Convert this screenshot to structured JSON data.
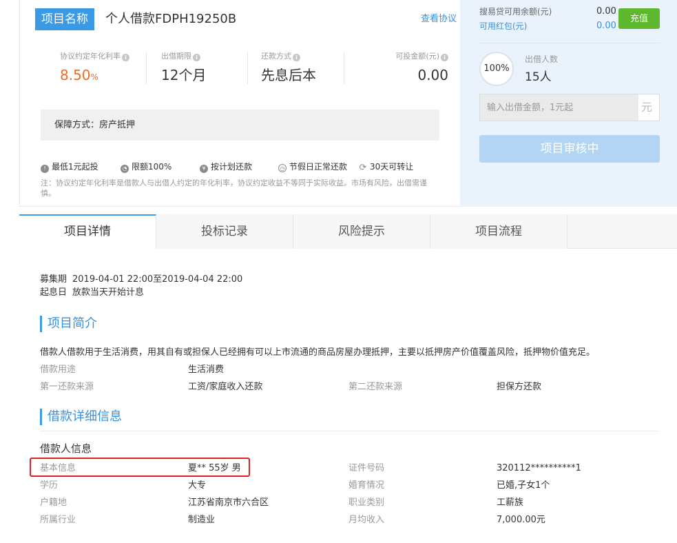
{
  "header": {
    "tag": "项目名称",
    "name": "个人借款FDPH19250B",
    "agreement_link": "查看协议"
  },
  "stats": [
    {
      "label": "协议约定年化利率",
      "value": "8.50",
      "unit": "%"
    },
    {
      "label": "出借期限",
      "value": "12个月"
    },
    {
      "label": "还款方式",
      "value": "先息后本"
    },
    {
      "label": "可投金额(元)",
      "value": "0.00"
    }
  ],
  "guarantee": "保障方式：房产抵押",
  "features": [
    {
      "icon": "info-icon",
      "label": "最低1元起投"
    },
    {
      "icon": "pie-icon",
      "label": "限额100%"
    },
    {
      "icon": "yen-icon",
      "label": "按计划还款"
    },
    {
      "icon": "clock-icon",
      "label": "节假日正常还款"
    },
    {
      "icon": "refresh-icon",
      "label": "30天可转让"
    }
  ],
  "note": "注：协议约定年化利率是借款人与出借人约定的年化利率，协议约定收益不等同于实际收益。市场有风险，出借需谨慎。",
  "right_panel": {
    "balance_label": "搜易贷可用余额(元)",
    "balance_value": "0.00",
    "redpacket_label": "可用红包(元)",
    "redpacket_value": "0.00",
    "recharge_button": "充值",
    "progress": "100%",
    "progress_fraction": 1.0,
    "investors_label": "出借人数",
    "investors_value": "15人",
    "amount_placeholder": "输入出借金额，1元起",
    "amount_unit": "元",
    "status_button": "项目审核中"
  },
  "tabs": [
    {
      "label": "项目详情",
      "active": true
    },
    {
      "label": "投标记录",
      "active": false
    },
    {
      "label": "风险提示",
      "active": false
    },
    {
      "label": "项目流程",
      "active": false
    }
  ],
  "schedule": {
    "raise_label": "募集期",
    "raise_value": "2019-04-01 22:00至2019-04-04 22:00",
    "interest_label": "起息日",
    "interest_value": "放款当天开始计息"
  },
  "intro": {
    "title": "项目简介",
    "description": "借款人借款用于生活消费，用其自有或担保人已经拥有可以上市流通的商品房屋办理抵押，主要以抵押房产价值覆盖风险，抵押物价值充足。",
    "rows": [
      {
        "label": "借款用途",
        "value": "生活消费"
      },
      {
        "label": "第一还款来源",
        "value": "工资/家庭收入还款",
        "label2": "第二还款来源",
        "value2": "担保方还款"
      }
    ]
  },
  "loan_detail": {
    "title": "借款详细信息",
    "subtitle": "借款人信息",
    "rows": [
      {
        "label": "基本信息",
        "value": "夏** 55岁 男",
        "label2": "证件号码",
        "value2": "320112**********1"
      },
      {
        "label": "学历",
        "value": "大专",
        "label2": "婚育情况",
        "value2": "已婚,子女1个"
      },
      {
        "label": "户籍地",
        "value": "江苏省南京市六合区",
        "label2": "职业类别",
        "value2": "工薪族"
      },
      {
        "label": "所属行业",
        "value": "制造业",
        "label2": "月均收入",
        "value2": "7,000.00元"
      }
    ]
  },
  "colors": {
    "accent": "#3a9ae6",
    "rate": "#f26b1d",
    "recharge": "#5db82d",
    "highlight": "#e02020"
  }
}
